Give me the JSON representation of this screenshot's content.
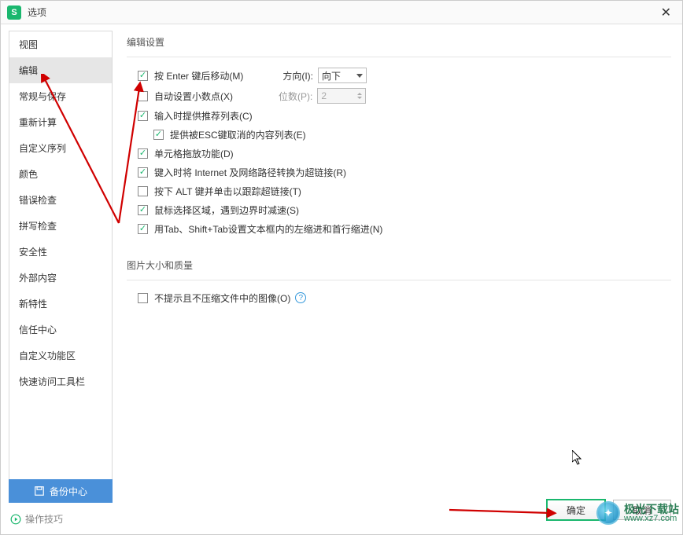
{
  "window": {
    "title": "选项",
    "icon_letter": "S"
  },
  "sidebar": {
    "items": [
      "视图",
      "编辑",
      "常规与保存",
      "重新计算",
      "自定义序列",
      "颜色",
      "错误检查",
      "拼写检查",
      "安全性",
      "外部内容",
      "新特性",
      "信任中心",
      "自定义功能区",
      "快速访问工具栏"
    ],
    "selected_index": 1
  },
  "content": {
    "section1_title": "编辑设置",
    "opt_enter_move": {
      "label": "按 Enter 键后移动(M)",
      "checked": true
    },
    "direction_label": "方向(I):",
    "direction_value": "向下",
    "opt_auto_decimal": {
      "label": "自动设置小数点(X)",
      "checked": false
    },
    "digits_label": "位数(P):",
    "digits_value": "2",
    "opt_autocomplete": {
      "label": "输入时提供推荐列表(C)",
      "checked": true
    },
    "opt_esc_list": {
      "label": "提供被ESC键取消的内容列表(E)",
      "checked": true
    },
    "opt_cell_drag": {
      "label": "单元格拖放功能(D)",
      "checked": true
    },
    "opt_hyperlink": {
      "label": "键入时将 Internet 及网络路径转换为超链接(R)",
      "checked": true
    },
    "opt_alt_click": {
      "label": "按下 ALT 键并单击以跟踪超链接(T)",
      "checked": false
    },
    "opt_mouse_slow": {
      "label": "鼠标选择区域，遇到边界时减速(S)",
      "checked": true
    },
    "opt_tab_indent": {
      "label": "用Tab、Shift+Tab设置文本框内的左缩进和首行缩进(N)",
      "checked": true
    },
    "section2_title": "图片大小和质量",
    "opt_no_compress": {
      "label": "不提示且不压缩文件中的图像(O)",
      "checked": false
    }
  },
  "footer": {
    "backup_center": "备份中心",
    "tips_label": "操作技巧",
    "ok_button": "确定",
    "cancel_button": "取消"
  },
  "watermark": {
    "line1": "极光下载站",
    "line2": "www.xz7.com"
  }
}
